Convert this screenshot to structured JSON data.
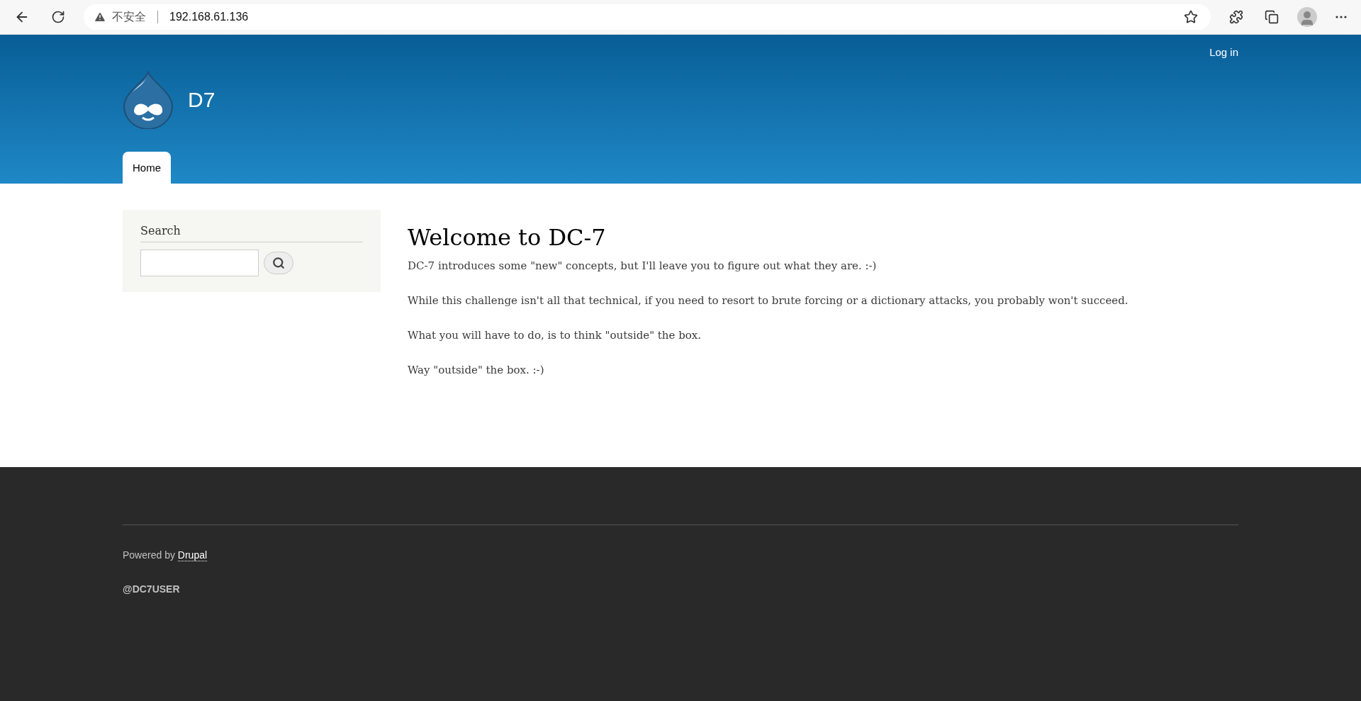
{
  "browser": {
    "security_label": "不安全",
    "url": "192.168.61.136"
  },
  "header": {
    "login": "Log in",
    "site_name": "D7",
    "tabs": [
      {
        "label": "Home",
        "selected": true
      }
    ]
  },
  "sidebar": {
    "title": "Search"
  },
  "main": {
    "title": "Welcome to DC-7",
    "paragraphs": [
      "DC-7 introduces some \"new\" concepts, but I'll leave you to figure out what they are.  :-)",
      "While this challenge isn't all that technical, if you need to resort to brute forcing or a dictionary attacks, you probably won't succeed.",
      "What you will have to do, is to think \"outside\" the box.",
      "Way \"outside\" the box.  :-)"
    ]
  },
  "footer": {
    "credit_prefix": "Powered by",
    "credit_link": "Drupal",
    "username": "@DC7USER"
  }
}
